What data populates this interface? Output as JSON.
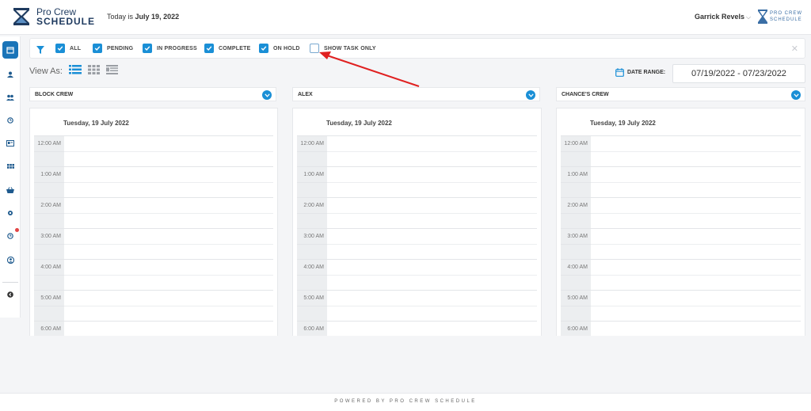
{
  "header": {
    "logo_line1": "Pro Crew",
    "logo_line2": "SCHEDULE",
    "today_prefix": "Today is",
    "today_date": "July 19, 2022",
    "user_name": "Garrick Revels",
    "small_logo_line1": "PRO CREW",
    "small_logo_line2": "SCHEDULE"
  },
  "sidebar": {
    "items": [
      "calendar-icon",
      "user-icon",
      "users-icon",
      "clock-icon",
      "id-card-icon",
      "grid-icon",
      "basket-icon",
      "gear-icon",
      "alarm-icon",
      "account-icon",
      "back-icon"
    ]
  },
  "filters": {
    "all": "ALL",
    "pending": "PENDING",
    "in_progress": "IN PROGRESS",
    "complete": "COMPLETE",
    "on_hold": "ON HOLD",
    "show_task_only": "SHOW TASK ONLY",
    "checked": [
      true,
      true,
      true,
      true,
      true,
      false
    ]
  },
  "view": {
    "label": "View As:",
    "date_range_label": "DATE RANGE:",
    "date_range_value": "07/19/2022 - 07/23/2022"
  },
  "columns": [
    {
      "name": "BLOCK CREW",
      "date": "Tuesday, 19 July 2022"
    },
    {
      "name": "ALEX",
      "date": "Tuesday, 19 July 2022"
    },
    {
      "name": "CHANCE'S CREW",
      "date": "Tuesday, 19 July 2022"
    }
  ],
  "hours": [
    "12:00 AM",
    "1:00 AM",
    "2:00 AM",
    "3:00 AM",
    "4:00 AM",
    "5:00 AM",
    "6:00 AM"
  ],
  "footer": {
    "text": "POWERED BY PRO CREW SCHEDULE"
  },
  "colors": {
    "accent": "#1a8fd6",
    "brand": "#1e3a5f",
    "annotation_arrow": "#e02020"
  }
}
